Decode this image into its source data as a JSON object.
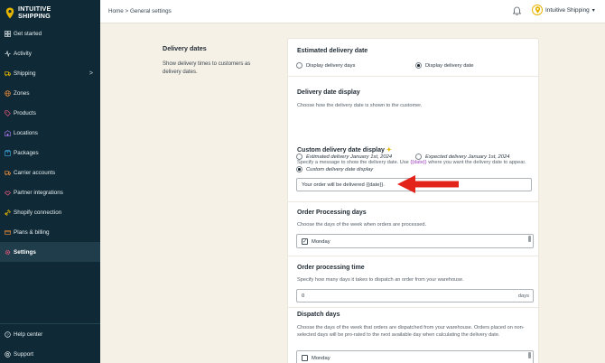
{
  "brand": {
    "line1": "INTUITIVE",
    "line2": "SHIPPING"
  },
  "sidebar": {
    "items": [
      {
        "label": "Get started",
        "icon": "grid-icon"
      },
      {
        "label": "Activity",
        "icon": "activity-icon"
      },
      {
        "label": "Shipping",
        "icon": "truck-icon",
        "chevron": ">"
      },
      {
        "label": "Zones",
        "icon": "globe-icon"
      },
      {
        "label": "Products",
        "icon": "tag-icon"
      },
      {
        "label": "Locations",
        "icon": "location-icon"
      },
      {
        "label": "Packages",
        "icon": "package-icon"
      },
      {
        "label": "Carrier accounts",
        "icon": "carrier-icon"
      },
      {
        "label": "Partner integrations",
        "icon": "handshake-icon"
      },
      {
        "label": "Shopify connection",
        "icon": "link-icon"
      },
      {
        "label": "Plans & billing",
        "icon": "billing-icon"
      },
      {
        "label": "Settings",
        "icon": "gear-icon",
        "active": true
      }
    ],
    "bottom": [
      {
        "label": "Help center",
        "icon": "help-icon"
      },
      {
        "label": "Support",
        "icon": "support-icon"
      }
    ]
  },
  "topbar": {
    "breadcrumb": "Home > General settings",
    "account_name": "Intuitive Shipping",
    "account_caret": "▾"
  },
  "section": {
    "title": "Delivery dates",
    "description": "Show delivery times to customers as delivery dates."
  },
  "estimated": {
    "heading": "Estimated delivery date",
    "option1": "Display delivery days",
    "option2": "Display delivery date",
    "selected": "option2"
  },
  "display": {
    "heading": "Delivery date display",
    "description": "Choose how the delivery date is shown to the customer.",
    "option1": "Estimated delivery January 1st, 2024",
    "option2": "Expected delivery January 1st, 2024",
    "option3": "Custom delivery date display",
    "selected": "option3"
  },
  "custom": {
    "heading": "Custom delivery date display",
    "desc_before": "Specify a message to show the delivery date. Use ",
    "desc_var": "{{date}}",
    "desc_after": " where you want the delivery date to appear.",
    "value": "Your order will be delivered {{date}}."
  },
  "processing_days": {
    "heading": "Order Processing days",
    "description": "Choose the days of the week when orders are processed.",
    "first_day": "Monday",
    "first_checked": true
  },
  "processing_time": {
    "heading": "Order processing time",
    "description": "Specify how many days it takes to dispatch an order from your warehouse.",
    "value": "0",
    "suffix": "days"
  },
  "dispatch": {
    "heading": "Dispatch days",
    "description": "Choose the days of the week that orders are dispatched from your warehouse. Orders placed on non-selected days will be pro-rated to the next available day when calculating the delivery date.",
    "first_day": "Monday",
    "first_checked": false
  },
  "colors": {
    "sidebar_bg": "#0f2a36",
    "accent_yellow": "#e5b400",
    "arrow_red": "#e3241b",
    "page_bg": "#f6f1e7"
  }
}
